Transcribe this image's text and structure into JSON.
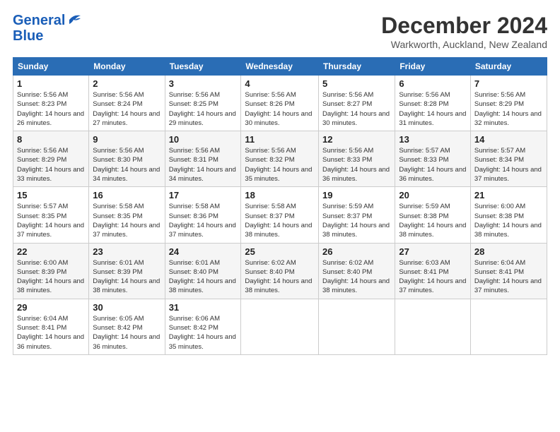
{
  "logo": {
    "line1": "General",
    "line2": "Blue"
  },
  "title": "December 2024",
  "subtitle": "Warkworth, Auckland, New Zealand",
  "weekdays": [
    "Sunday",
    "Monday",
    "Tuesday",
    "Wednesday",
    "Thursday",
    "Friday",
    "Saturday"
  ],
  "weeks": [
    [
      {
        "day": "1",
        "sunrise": "5:56 AM",
        "sunset": "8:23 PM",
        "daylight": "14 hours and 26 minutes."
      },
      {
        "day": "2",
        "sunrise": "5:56 AM",
        "sunset": "8:24 PM",
        "daylight": "14 hours and 27 minutes."
      },
      {
        "day": "3",
        "sunrise": "5:56 AM",
        "sunset": "8:25 PM",
        "daylight": "14 hours and 29 minutes."
      },
      {
        "day": "4",
        "sunrise": "5:56 AM",
        "sunset": "8:26 PM",
        "daylight": "14 hours and 30 minutes."
      },
      {
        "day": "5",
        "sunrise": "5:56 AM",
        "sunset": "8:27 PM",
        "daylight": "14 hours and 30 minutes."
      },
      {
        "day": "6",
        "sunrise": "5:56 AM",
        "sunset": "8:28 PM",
        "daylight": "14 hours and 31 minutes."
      },
      {
        "day": "7",
        "sunrise": "5:56 AM",
        "sunset": "8:29 PM",
        "daylight": "14 hours and 32 minutes."
      }
    ],
    [
      {
        "day": "8",
        "sunrise": "5:56 AM",
        "sunset": "8:29 PM",
        "daylight": "14 hours and 33 minutes."
      },
      {
        "day": "9",
        "sunrise": "5:56 AM",
        "sunset": "8:30 PM",
        "daylight": "14 hours and 34 minutes."
      },
      {
        "day": "10",
        "sunrise": "5:56 AM",
        "sunset": "8:31 PM",
        "daylight": "14 hours and 34 minutes."
      },
      {
        "day": "11",
        "sunrise": "5:56 AM",
        "sunset": "8:32 PM",
        "daylight": "14 hours and 35 minutes."
      },
      {
        "day": "12",
        "sunrise": "5:56 AM",
        "sunset": "8:33 PM",
        "daylight": "14 hours and 36 minutes."
      },
      {
        "day": "13",
        "sunrise": "5:57 AM",
        "sunset": "8:33 PM",
        "daylight": "14 hours and 36 minutes."
      },
      {
        "day": "14",
        "sunrise": "5:57 AM",
        "sunset": "8:34 PM",
        "daylight": "14 hours and 37 minutes."
      }
    ],
    [
      {
        "day": "15",
        "sunrise": "5:57 AM",
        "sunset": "8:35 PM",
        "daylight": "14 hours and 37 minutes."
      },
      {
        "day": "16",
        "sunrise": "5:58 AM",
        "sunset": "8:35 PM",
        "daylight": "14 hours and 37 minutes."
      },
      {
        "day": "17",
        "sunrise": "5:58 AM",
        "sunset": "8:36 PM",
        "daylight": "14 hours and 37 minutes."
      },
      {
        "day": "18",
        "sunrise": "5:58 AM",
        "sunset": "8:37 PM",
        "daylight": "14 hours and 38 minutes."
      },
      {
        "day": "19",
        "sunrise": "5:59 AM",
        "sunset": "8:37 PM",
        "daylight": "14 hours and 38 minutes."
      },
      {
        "day": "20",
        "sunrise": "5:59 AM",
        "sunset": "8:38 PM",
        "daylight": "14 hours and 38 minutes."
      },
      {
        "day": "21",
        "sunrise": "6:00 AM",
        "sunset": "8:38 PM",
        "daylight": "14 hours and 38 minutes."
      }
    ],
    [
      {
        "day": "22",
        "sunrise": "6:00 AM",
        "sunset": "8:39 PM",
        "daylight": "14 hours and 38 minutes."
      },
      {
        "day": "23",
        "sunrise": "6:01 AM",
        "sunset": "8:39 PM",
        "daylight": "14 hours and 38 minutes."
      },
      {
        "day": "24",
        "sunrise": "6:01 AM",
        "sunset": "8:40 PM",
        "daylight": "14 hours and 38 minutes."
      },
      {
        "day": "25",
        "sunrise": "6:02 AM",
        "sunset": "8:40 PM",
        "daylight": "14 hours and 38 minutes."
      },
      {
        "day": "26",
        "sunrise": "6:02 AM",
        "sunset": "8:40 PM",
        "daylight": "14 hours and 38 minutes."
      },
      {
        "day": "27",
        "sunrise": "6:03 AM",
        "sunset": "8:41 PM",
        "daylight": "14 hours and 37 minutes."
      },
      {
        "day": "28",
        "sunrise": "6:04 AM",
        "sunset": "8:41 PM",
        "daylight": "14 hours and 37 minutes."
      }
    ],
    [
      {
        "day": "29",
        "sunrise": "6:04 AM",
        "sunset": "8:41 PM",
        "daylight": "14 hours and 36 minutes."
      },
      {
        "day": "30",
        "sunrise": "6:05 AM",
        "sunset": "8:42 PM",
        "daylight": "14 hours and 36 minutes."
      },
      {
        "day": "31",
        "sunrise": "6:06 AM",
        "sunset": "8:42 PM",
        "daylight": "14 hours and 35 minutes."
      },
      null,
      null,
      null,
      null
    ]
  ]
}
